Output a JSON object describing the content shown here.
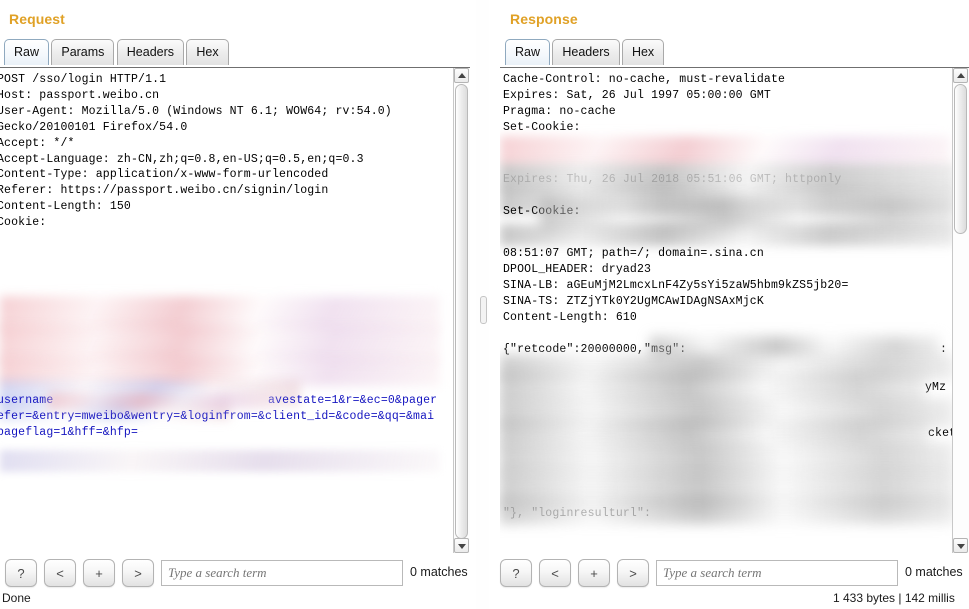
{
  "request": {
    "title": "Request",
    "tabs": [
      {
        "label": "Raw",
        "active": true
      },
      {
        "label": "Params",
        "active": false
      },
      {
        "label": "Headers",
        "active": false
      },
      {
        "label": "Hex",
        "active": false
      }
    ],
    "headers_text": "POST /sso/login HTTP/1.1\nHost: passport.weibo.cn\nUser-Agent: Mozilla/5.0 (Windows NT 6.1; WOW64; rv:54.0)\nGecko/20100101 Firefox/54.0\nAccept: */*\nAccept-Language: zh-CN,zh;q=0.8,en-US;q=0.5,en;q=0.3\nContent-Type: application/x-www-form-urlencoded\nReferer: https://passport.weibo.cn/signin/login\nContent-Length: 150\nCookie:",
    "body_line1_prefix": "username",
    "body_line1_suffix": "avestate=1&r=&ec=0&pager",
    "body_line2": "efer=&entry=mweibo&wentry=&loginfrom=&client_id=&code=&qq=&mai",
    "body_line3": "pageflag=1&hff=&hfp=",
    "search": {
      "placeholder": "Type a search term",
      "value": "",
      "matches": "0 matches"
    },
    "buttons": {
      "help": "?",
      "prev": "<",
      "add": "+",
      "next": ">"
    }
  },
  "response": {
    "title": "Response",
    "tabs": [
      {
        "label": "Raw",
        "active": true
      },
      {
        "label": "Headers",
        "active": false
      },
      {
        "label": "Hex",
        "active": false
      }
    ],
    "headers_text": "Cache-Control: no-cache, must-revalidate\nExpires: Sat, 26 Jul 1997 05:00:00 GMT\nPragma: no-cache\nSet-Cookie:",
    "redacted_line_expires": "Expires: Thu, 26 Jul 2018 05:51:06 GMT; httponly",
    "redacted_line_setcookie": "Set-Cookie:",
    "tail_text": "08:51:07 GMT; path=/; domain=.sina.cn\nDPOOL_HEADER: dryad23\nSINA-LB: aGEuMjM2LmcxLnF4Zy5sYi5zaW5hbm9kZS5jb20=\nSINA-TS: ZTZjYTk0Y2UgMCAwIDAgNSAxMjcK\nContent-Length: 610",
    "json_line1": "{\"retcode\":20000000,\"msg\":",
    "json_fragment_colon": ":",
    "json_fragment_mz": "yMz",
    "json_fragment_ticket": "cket",
    "json_last_line": "\"}, \"loginresulturl\":",
    "search": {
      "placeholder": "Type a search term",
      "value": "",
      "matches": "0 matches"
    },
    "buttons": {
      "help": "?",
      "prev": "<",
      "add": "+",
      "next": ">"
    }
  },
  "status": {
    "left": "Done",
    "right": "1 433 bytes | 142 millis"
  },
  "colors": {
    "panel_title": "#e0a126",
    "param_key": "#1515c0",
    "param_sep": "#c23131",
    "active_tab_border": "#8fa9bf"
  }
}
